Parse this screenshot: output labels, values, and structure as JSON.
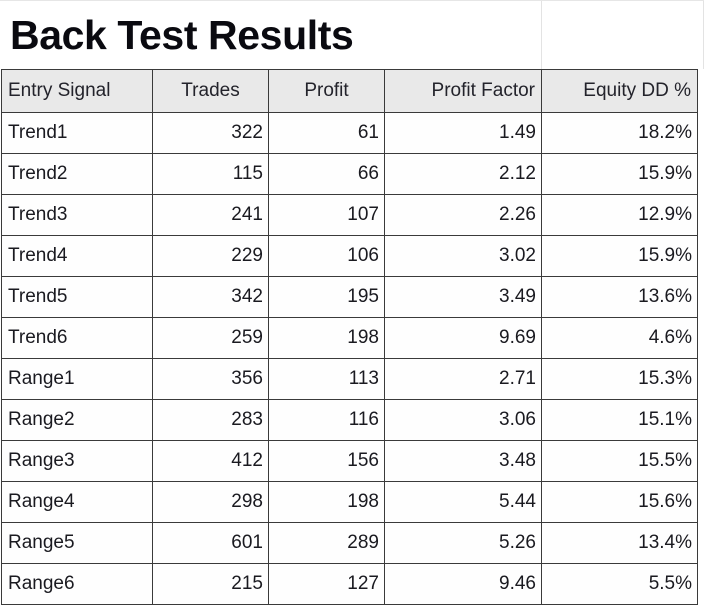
{
  "title": "Back Test Results",
  "table": {
    "columns": [
      {
        "key": "entry_signal",
        "label": "Entry Signal",
        "align": "left"
      },
      {
        "key": "trades",
        "label": "Trades",
        "align": "center"
      },
      {
        "key": "profit",
        "label": "Profit",
        "align": "center"
      },
      {
        "key": "profit_factor",
        "label": "Profit Factor",
        "align": "right"
      },
      {
        "key": "equity_dd",
        "label": "Equity DD %",
        "align": "right"
      }
    ],
    "rows": [
      {
        "entry_signal": "Trend1",
        "trades": "322",
        "profit": "61",
        "profit_factor": "1.49",
        "equity_dd": "18.2%"
      },
      {
        "entry_signal": "Trend2",
        "trades": "115",
        "profit": "66",
        "profit_factor": "2.12",
        "equity_dd": "15.9%"
      },
      {
        "entry_signal": "Trend3",
        "trades": "241",
        "profit": "107",
        "profit_factor": "2.26",
        "equity_dd": "12.9%"
      },
      {
        "entry_signal": "Trend4",
        "trades": "229",
        "profit": "106",
        "profit_factor": "3.02",
        "equity_dd": "15.9%"
      },
      {
        "entry_signal": "Trend5",
        "trades": "342",
        "profit": "195",
        "profit_factor": "3.49",
        "equity_dd": "13.6%"
      },
      {
        "entry_signal": "Trend6",
        "trades": "259",
        "profit": "198",
        "profit_factor": "9.69",
        "equity_dd": "4.6%"
      },
      {
        "entry_signal": "Range1",
        "trades": "356",
        "profit": "113",
        "profit_factor": "2.71",
        "equity_dd": "15.3%"
      },
      {
        "entry_signal": "Range2",
        "trades": "283",
        "profit": "116",
        "profit_factor": "3.06",
        "equity_dd": "15.1%"
      },
      {
        "entry_signal": "Range3",
        "trades": "412",
        "profit": "156",
        "profit_factor": "3.48",
        "equity_dd": "15.5%"
      },
      {
        "entry_signal": "Range4",
        "trades": "298",
        "profit": "198",
        "profit_factor": "5.44",
        "equity_dd": "15.6%"
      },
      {
        "entry_signal": "Range5",
        "trades": "601",
        "profit": "289",
        "profit_factor": "5.26",
        "equity_dd": "13.4%"
      },
      {
        "entry_signal": "Range6",
        "trades": "215",
        "profit": "127",
        "profit_factor": "9.46",
        "equity_dd": "5.5%"
      }
    ]
  },
  "colors": {
    "header_background": "#e9e9e9",
    "grid_line": "#3a3a3a",
    "title_text": "#0a0a10",
    "body_text": "#1a1a20",
    "page_background": "#ffffff"
  }
}
